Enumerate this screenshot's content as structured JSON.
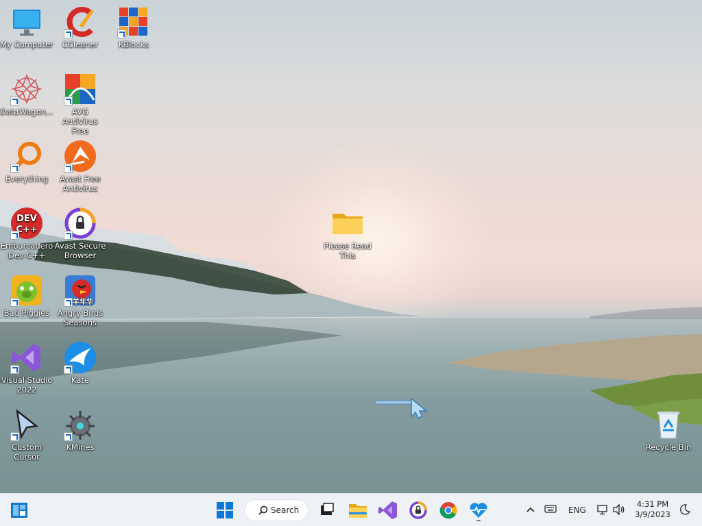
{
  "desktop_icons": [
    {
      "label": "My Computer",
      "icon": "monitor-icon"
    },
    {
      "label": "CCleaner",
      "icon": "ccleaner-icon"
    },
    {
      "label": "KBlocks",
      "icon": "kblocks-icon"
    },
    {
      "label": "DataWagon...",
      "icon": "datawagon-icon"
    },
    {
      "label": "AVG AntiVirus Free",
      "icon": "avg-icon"
    },
    {
      "label": "Everything",
      "icon": "magnifier-icon"
    },
    {
      "label": "Avast Free Antivirus",
      "icon": "avast-icon"
    },
    {
      "label": "Embarcadero Dev-C++",
      "icon": "devcpp-icon",
      "badge": "DEV C++"
    },
    {
      "label": "Avast Secure Browser",
      "icon": "avast-browser-icon"
    },
    {
      "label": "Bad Piggies",
      "icon": "bad-piggies-icon"
    },
    {
      "label": "Angry Birds Seasons",
      "icon": "angry-birds-icon",
      "badge": "羊年华"
    },
    {
      "label": "Visual Studio 2022",
      "icon": "visual-studio-icon"
    },
    {
      "label": "Kate",
      "icon": "kate-icon"
    },
    {
      "label": "Custom Cursor",
      "icon": "cursor-icon"
    },
    {
      "label": "KMines",
      "icon": "kmines-icon"
    },
    {
      "label": "Please Read This",
      "icon": "folder-icon"
    },
    {
      "label": "Recycle Bin",
      "icon": "recycle-bin-icon"
    }
  ],
  "taskbar": {
    "search_label": "Search",
    "language": "ENG",
    "time": "4:31 PM",
    "date": "3/9/2023",
    "pinned": [
      "start-icon",
      "task-view-icon",
      "file-explorer-icon",
      "visual-studio-icon",
      "avast-browser-icon",
      "chrome-icon",
      "health-monitor-icon"
    ]
  },
  "colors": {
    "taskbar_bg": "#eef1f6",
    "windows_blue": "#0a78d4"
  }
}
